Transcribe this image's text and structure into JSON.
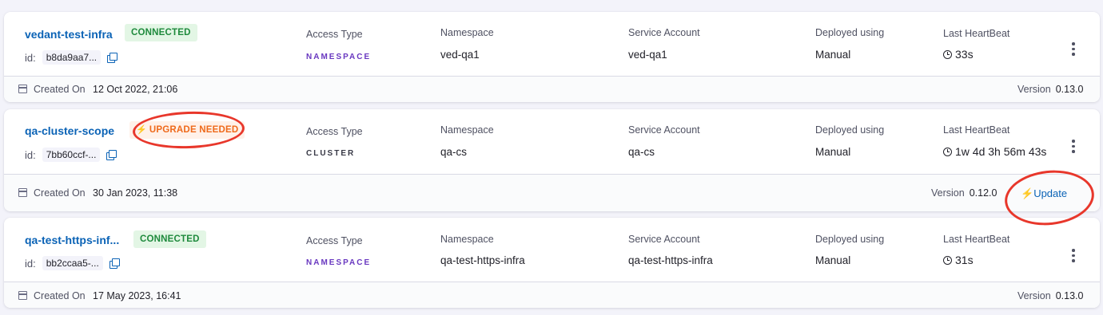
{
  "infrastructures": [
    {
      "name": "vedant-test-infra",
      "status": "CONNECTED",
      "id_label": "id:",
      "id": "b8da9aa7...",
      "access_type_label": "Access Type",
      "access_type": "NAMESPACE",
      "namespace_label": "Namespace",
      "namespace": "ved-qa1",
      "service_account_label": "Service Account",
      "service_account": "ved-qa1",
      "deployed_label": "Deployed using",
      "deployed": "Manual",
      "heartbeat_label": "Last HeartBeat",
      "heartbeat": "33s",
      "created_label": "Created On",
      "created": "12 Oct 2022, 21:06",
      "version_label": "Version",
      "version": "0.13.0"
    },
    {
      "name": "qa-cluster-scope",
      "status": "UPGRADE NEEDED",
      "id_label": "id:",
      "id": "7bb60ccf-...",
      "access_type_label": "Access Type",
      "access_type": "CLUSTER",
      "namespace_label": "Namespace",
      "namespace": "qa-cs",
      "service_account_label": "Service Account",
      "service_account": "qa-cs",
      "deployed_label": "Deployed using",
      "deployed": "Manual",
      "heartbeat_label": "Last HeartBeat",
      "heartbeat": "1w 4d 3h 56m 43s",
      "created_label": "Created On",
      "created": "30 Jan 2023, 11:38",
      "version_label": "Version",
      "version": "0.12.0",
      "update_label": "Update"
    },
    {
      "name": "qa-test-https-inf...",
      "status": "CONNECTED",
      "id_label": "id:",
      "id": "bb2ccaa5-...",
      "access_type_label": "Access Type",
      "access_type": "NAMESPACE",
      "namespace_label": "Namespace",
      "namespace": "qa-test-https-infra",
      "service_account_label": "Service Account",
      "service_account": "qa-test-https-infra",
      "deployed_label": "Deployed using",
      "deployed": "Manual",
      "heartbeat_label": "Last HeartBeat",
      "heartbeat": "31s",
      "created_label": "Created On",
      "created": "17 May 2023, 16:41",
      "version_label": "Version",
      "version": "0.13.0"
    }
  ],
  "colors": {
    "accent": "#0b63b6",
    "connected": "#1e8a3c",
    "upgrade": "#ef6a1b",
    "namespace_access": "#6938c0",
    "annotation": "#e8372b"
  },
  "icons": [
    "copy-icon",
    "clock-icon",
    "more-options-icon",
    "calendar-icon",
    "lightning-icon"
  ]
}
